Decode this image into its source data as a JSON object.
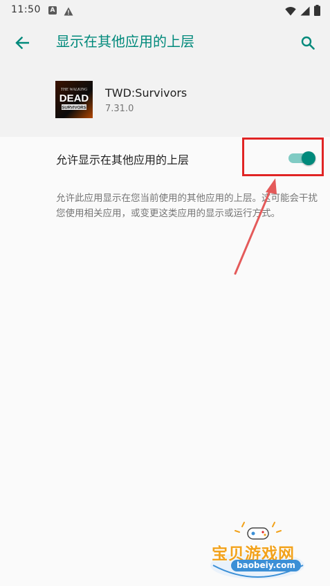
{
  "status_bar": {
    "time": "11:50",
    "icons": [
      "notification-a-icon",
      "warning-icon",
      "wifi-icon",
      "signal-icon",
      "battery-icon"
    ]
  },
  "header": {
    "title": "显示在其他应用的上层",
    "back_icon": "arrow-left-icon",
    "search_icon": "search-icon"
  },
  "app": {
    "name": "TWD:Survivors",
    "version": "7.31.0",
    "icon_text_top": "THE WALKING",
    "icon_text_main": "DEAD",
    "icon_text_bottom": "SURVIVORS"
  },
  "setting": {
    "label": "允许显示在其他应用的上层",
    "enabled": true
  },
  "description": "允许此应用显示在您当前使用的其他应用的上层。这可能会干扰您使用相关应用，或变更这类应用的显示或运行方式。",
  "watermark": {
    "text": "宝贝游戏网",
    "url": "baobeiy.com"
  },
  "colors": {
    "accent": "#00897b",
    "toggle_track": "#80cbc4",
    "highlight": "#e02424",
    "header_bg": "#f2f2f2",
    "page_bg": "#fafafa"
  }
}
